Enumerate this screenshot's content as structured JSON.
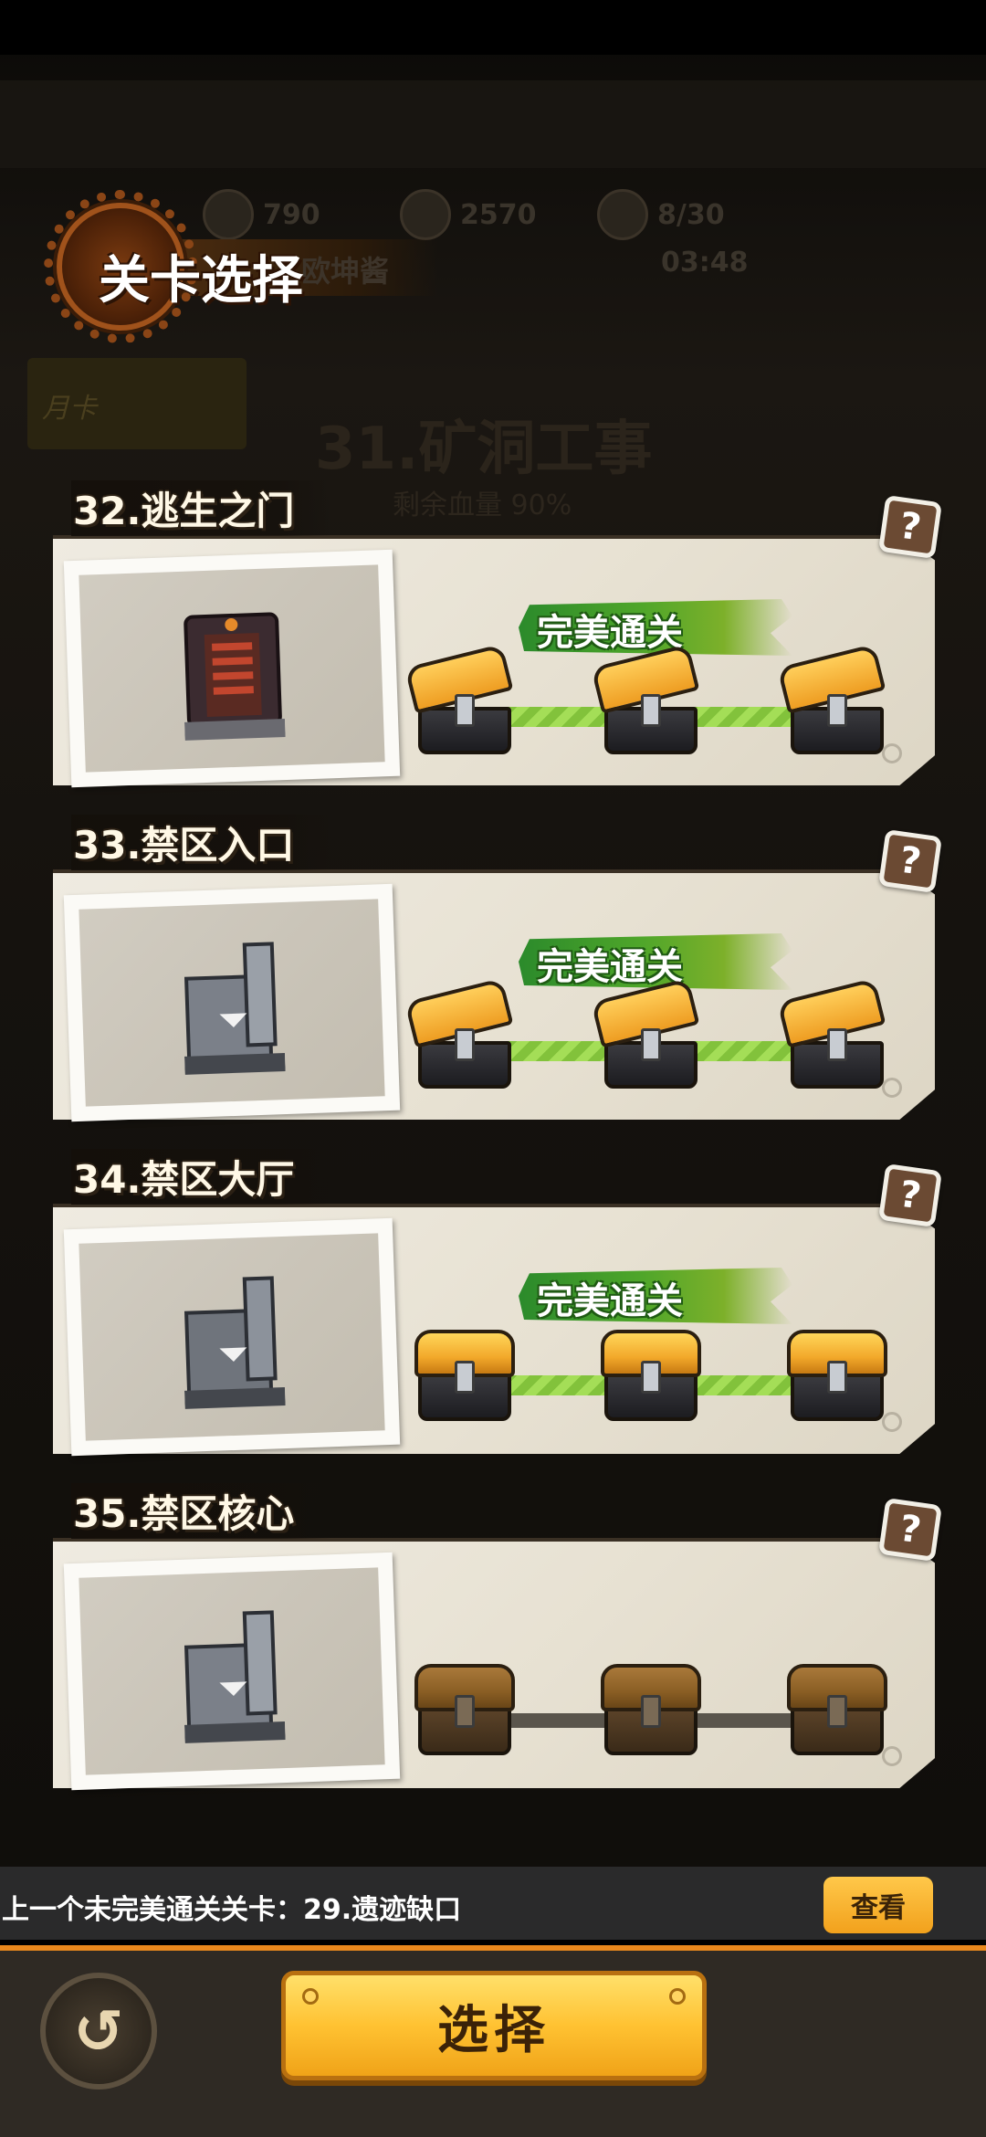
{
  "header": {
    "title": "关卡选择",
    "subtitle": "欧坤酱"
  },
  "resources": [
    {
      "value": "790"
    },
    {
      "value": "2570"
    },
    {
      "value": "8/30",
      "timer": "03:48"
    }
  ],
  "background": {
    "stage_title": "31.矿洞工事",
    "hint": "剩余血量 90%",
    "card_label": "月卡"
  },
  "levels": [
    {
      "title": "32.逃生之门",
      "status": "完美通关",
      "chests": "open",
      "building": "red-door-icon"
    },
    {
      "title": "33.禁区入口",
      "status": "完美通关",
      "chests": "open",
      "building": "gray-fortress-icon"
    },
    {
      "title": "34.禁区大厅",
      "status": "完美通关",
      "chests": "gold",
      "building": "gray-fortress-icon"
    },
    {
      "title": "35.禁区核心",
      "status": "",
      "chests": "locked",
      "building": "gray-fortress-icon"
    }
  ],
  "info_bar": {
    "text": "上一个未完美通关关卡：29.遗迹缺口",
    "view_label": "查看"
  },
  "footer": {
    "select_label": "选择",
    "back_icon": "back-arrow-icon"
  },
  "colors": {
    "accent": "#f2a11c",
    "footer_border": "#e9881d",
    "perfect_green": "#4fa62a"
  }
}
